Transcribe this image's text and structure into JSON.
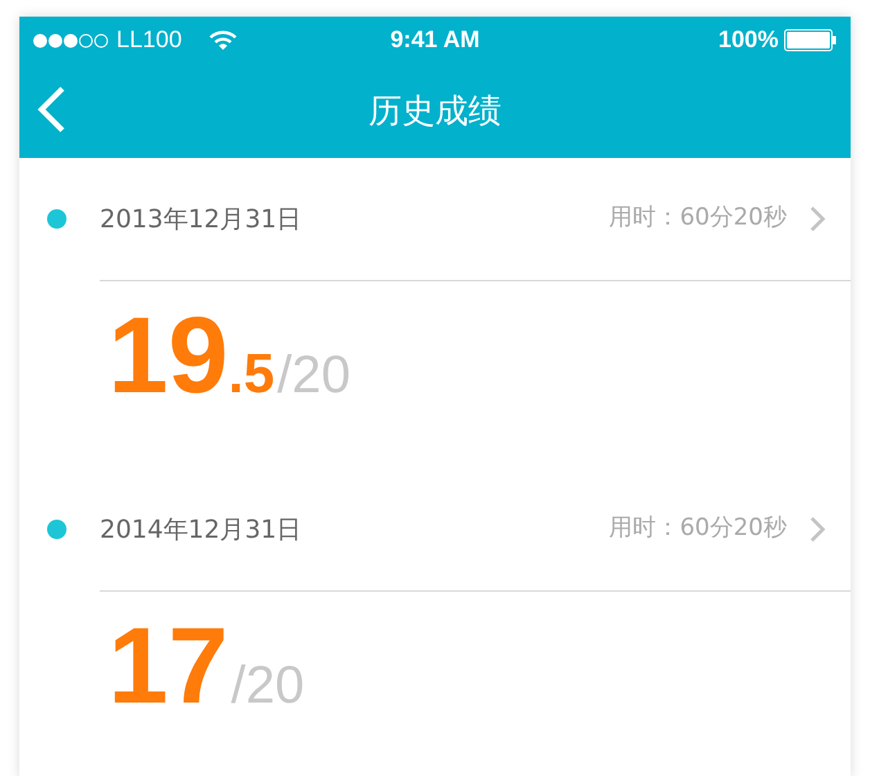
{
  "status_bar": {
    "carrier": "LL100",
    "time": "9:41 AM",
    "battery": "100%"
  },
  "nav_bar": {
    "title": "历史成绩"
  },
  "records": [
    {
      "date": "2013年12月31日",
      "duration": "用时：60分20秒",
      "score": "19",
      "fraction": ".5",
      "total": "/20"
    },
    {
      "date": "2014年12月31日",
      "duration": "用时：60分20秒",
      "score": "17",
      "total": "/20"
    }
  ]
}
